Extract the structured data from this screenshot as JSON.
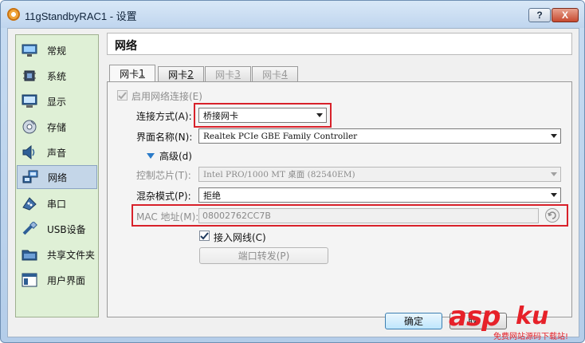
{
  "window": {
    "title": "11gStandbyRAC1 - 设置",
    "help_label": "?",
    "close_label": "X"
  },
  "sidebar": {
    "items": [
      {
        "label": "常规",
        "icon": "general-monitor-icon"
      },
      {
        "label": "系统",
        "icon": "system-chip-icon"
      },
      {
        "label": "显示",
        "icon": "display-monitor-icon"
      },
      {
        "label": "存储",
        "icon": "storage-disk-icon"
      },
      {
        "label": "声音",
        "icon": "audio-speaker-icon"
      },
      {
        "label": "网络",
        "icon": "network-icon"
      },
      {
        "label": "串口",
        "icon": "serial-port-icon"
      },
      {
        "label": "USB设备",
        "icon": "usb-icon"
      },
      {
        "label": "共享文件夹",
        "icon": "shared-folder-icon"
      },
      {
        "label": "用户界面",
        "icon": "user-interface-icon"
      }
    ],
    "active_index": 5
  },
  "page": {
    "title": "网络"
  },
  "tabs": [
    {
      "label": "网卡 ",
      "key": "1",
      "disabled": false
    },
    {
      "label": "网卡 ",
      "key": "2",
      "disabled": false
    },
    {
      "label": "网卡 ",
      "key": "3",
      "disabled": true
    },
    {
      "label": "网卡 ",
      "key": "4",
      "disabled": true
    }
  ],
  "adapter": {
    "enable_label": "启用网络连接(E)",
    "enable_checked": true,
    "attached_to_label": "连接方式(A):",
    "attached_to_value": "桥接网卡",
    "name_label": "界面名称(N):",
    "name_value": "Realtek PCIe GBE Family Controller",
    "advanced_label": "高级(d)",
    "adapter_type_label": "控制芯片(T):",
    "adapter_type_value": "Intel PRO/1000 MT 桌面 (82540EM)",
    "promiscuous_label": "混杂模式(P):",
    "promiscuous_value": "拒绝",
    "mac_label": "MAC 地址(M):",
    "mac_value": "08002762CC7B",
    "cable_label": "接入网线(C)",
    "cable_checked": true,
    "port_forward_label": "端口转发(P)"
  },
  "footer": {
    "ok_label": "确定",
    "cancel_label": "取"
  },
  "watermark": {
    "brand": "asp",
    "brand_suffix": "ku",
    "tagline": "免费网站源码下载站!"
  },
  "colors": {
    "highlight_box": "#d8212a",
    "sidebar_bg": "#dff0d6",
    "active_item": "#c4d6e8",
    "expander_arrow": "#2a7bc9"
  }
}
